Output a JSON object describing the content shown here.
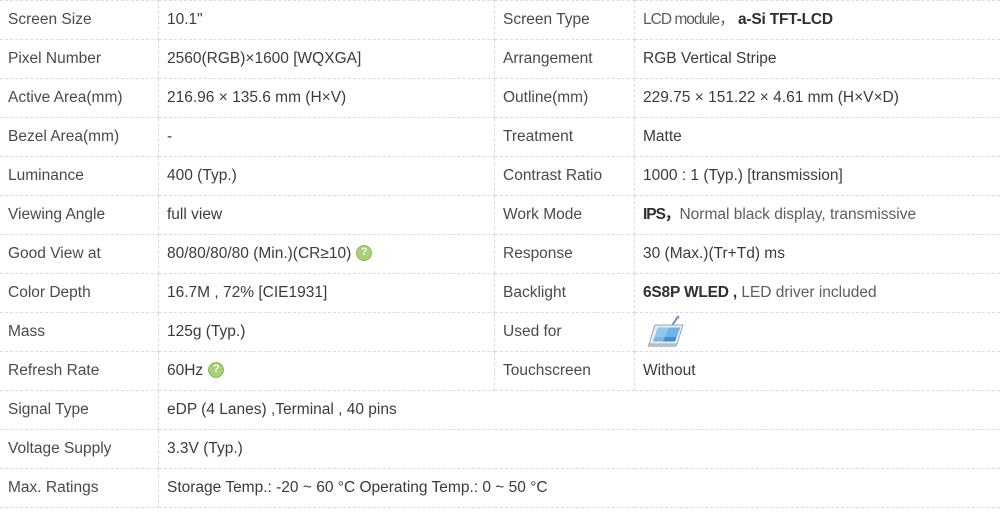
{
  "table": {
    "rows": [
      {
        "left_label": "Screen Size",
        "left_value": "10.1\"",
        "right_label": "Screen Type",
        "right_value_dim": "LCD module，",
        "right_value_strong": "a-Si TFT-LCD"
      },
      {
        "left_label": "Pixel Number",
        "left_value": "2560(RGB)×1600   [WQXGA]",
        "right_label": "Arrangement",
        "right_value": "RGB Vertical Stripe"
      },
      {
        "left_label": "Active Area(mm)",
        "left_value": "216.96 × 135.6 mm (H×V)",
        "right_label": "Outline(mm)",
        "right_value": "229.75 × 151.22 × 4.61 mm (H×V×D)"
      },
      {
        "left_label": "Bezel Area(mm)",
        "left_value": "-",
        "right_label": "Treatment",
        "right_value": "Matte"
      },
      {
        "left_label": "Luminance",
        "left_value": "400 (Typ.)",
        "right_label": "Contrast Ratio",
        "right_value": "1000 : 1 (Typ.) [transmission]"
      },
      {
        "left_label": "Viewing Angle",
        "left_value": "full view",
        "right_label": "Work Mode",
        "right_value_strong": "IPS，",
        "right_value_dim": "Normal black display, transmissive"
      },
      {
        "left_label": "Good View at",
        "left_value": "80/80/80/80 (Min.)(CR≥10)",
        "left_help_icon": "help-question-icon",
        "right_label": "Response",
        "right_value": "30 (Max.)(Tr+Td) ms"
      },
      {
        "left_label": "Color Depth",
        "left_value": "16.7M , 72% [CIE1931]",
        "right_label": "Backlight",
        "right_value_strong": "6S8P WLED ,",
        "right_value_dim": "LED driver included"
      },
      {
        "left_label": "Mass",
        "left_value": "125g (Typ.)",
        "right_label": "Used for",
        "right_value_icon": "tablet-pc-icon"
      },
      {
        "left_label": "Refresh Rate",
        "left_value": "60Hz",
        "left_help_icon": "help-question-icon",
        "right_label": "Touchscreen",
        "right_value": "Without"
      }
    ],
    "wide_rows": [
      {
        "label": "Signal Type",
        "value": "eDP (4 Lanes) ,Terminal   , 40 pins"
      },
      {
        "label": "Voltage Supply",
        "value": "3.3V (Typ.)"
      },
      {
        "label": "Max. Ratings",
        "value": "Storage Temp.: -20 ~ 60 °C  Operating Temp.: 0 ~ 50 °C"
      }
    ]
  },
  "colors": {
    "help_badge": "#a9cf77",
    "help_badge_border": "#8cba55",
    "grid_line": "#dcdcdc",
    "label_text": "#4a4a4a",
    "value_text": "#3b3b3b"
  }
}
